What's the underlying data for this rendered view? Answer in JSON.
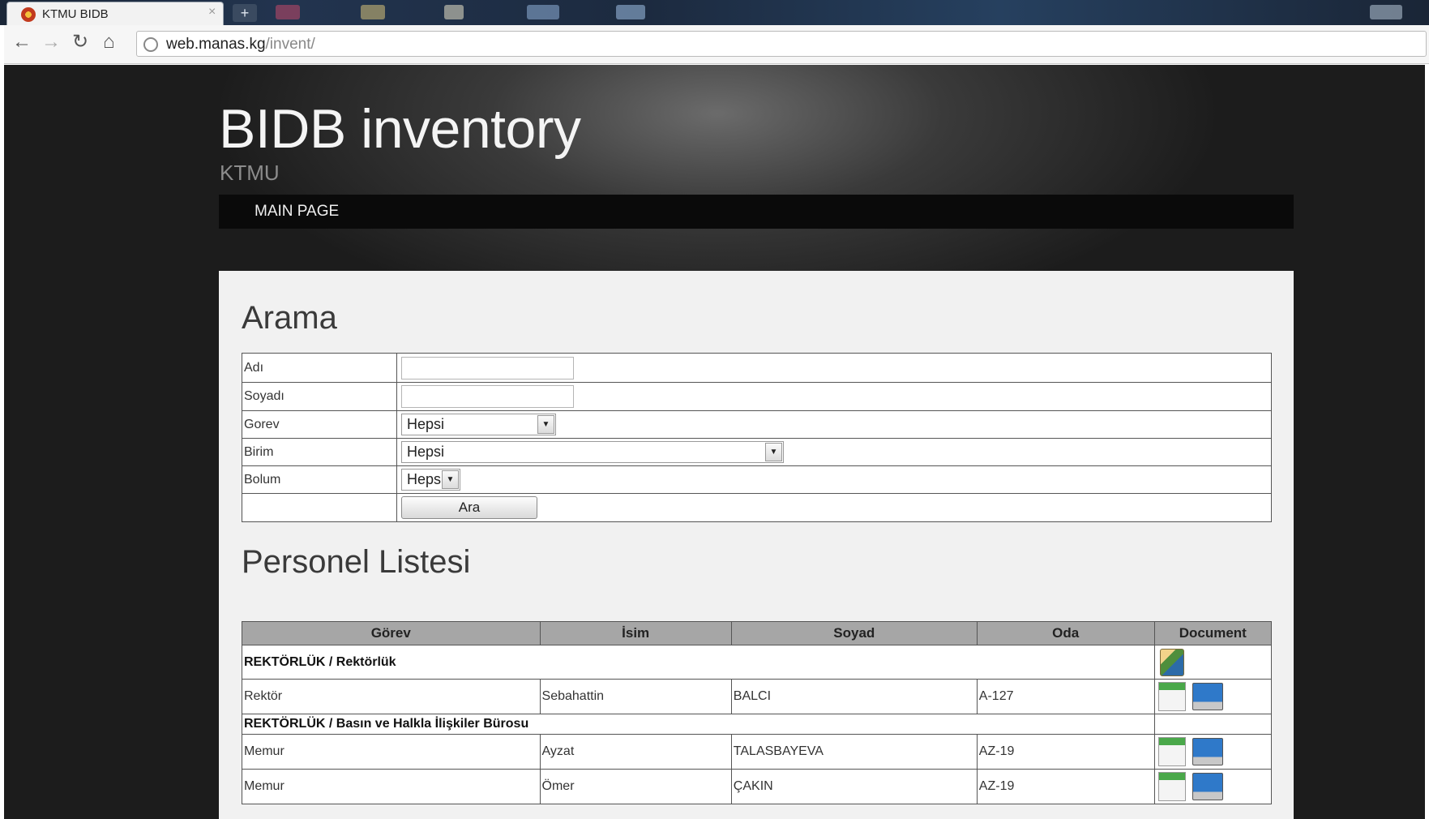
{
  "browser": {
    "tab_title": "KTMU BIDB",
    "tab_close": "×",
    "new_tab": "+",
    "url_host": "web.manas.kg",
    "url_path": "/invent/"
  },
  "site": {
    "title": "BIDB inventory",
    "subtitle": "KTMU",
    "nav": [
      "MAIN PAGE"
    ]
  },
  "search": {
    "heading": "Arama",
    "fields": {
      "adi_label": "Adı",
      "adi_value": "",
      "soyadi_label": "Soyadı",
      "soyadi_value": "",
      "gorev_label": "Gorev",
      "gorev_selected": "Hepsi",
      "birim_label": "Birim",
      "birim_selected": "Hepsi",
      "bolum_label": "Bolum",
      "bolum_selected": "Hepsi"
    },
    "submit_label": "Ara"
  },
  "personnel": {
    "heading": "Personel Listesi",
    "columns": [
      "Görev",
      "İsim",
      "Soyad",
      "Oda",
      "Document"
    ],
    "groups": [
      {
        "name": "REKTÖRLÜK / Rektörlük",
        "rows": [
          {
            "gorev": "Rektör",
            "isim": "Sebahattin",
            "soyad": "BALCI",
            "oda": "A-127"
          }
        ]
      },
      {
        "name": "REKTÖRLÜK / Basın ve Halkla İlişkiler Bürosu",
        "rows": [
          {
            "gorev": "Memur",
            "isim": "Ayzat",
            "soyad": "TALASBAYEVA",
            "oda": "AZ-19"
          },
          {
            "gorev": "Memur",
            "isim": "Ömer",
            "soyad": "ÇAKIN",
            "oda": "AZ-19"
          }
        ]
      }
    ]
  },
  "icons": {
    "group_document": "book-icon",
    "row_sheet": "spreadsheet-icon",
    "row_computer": "computer-icon"
  }
}
